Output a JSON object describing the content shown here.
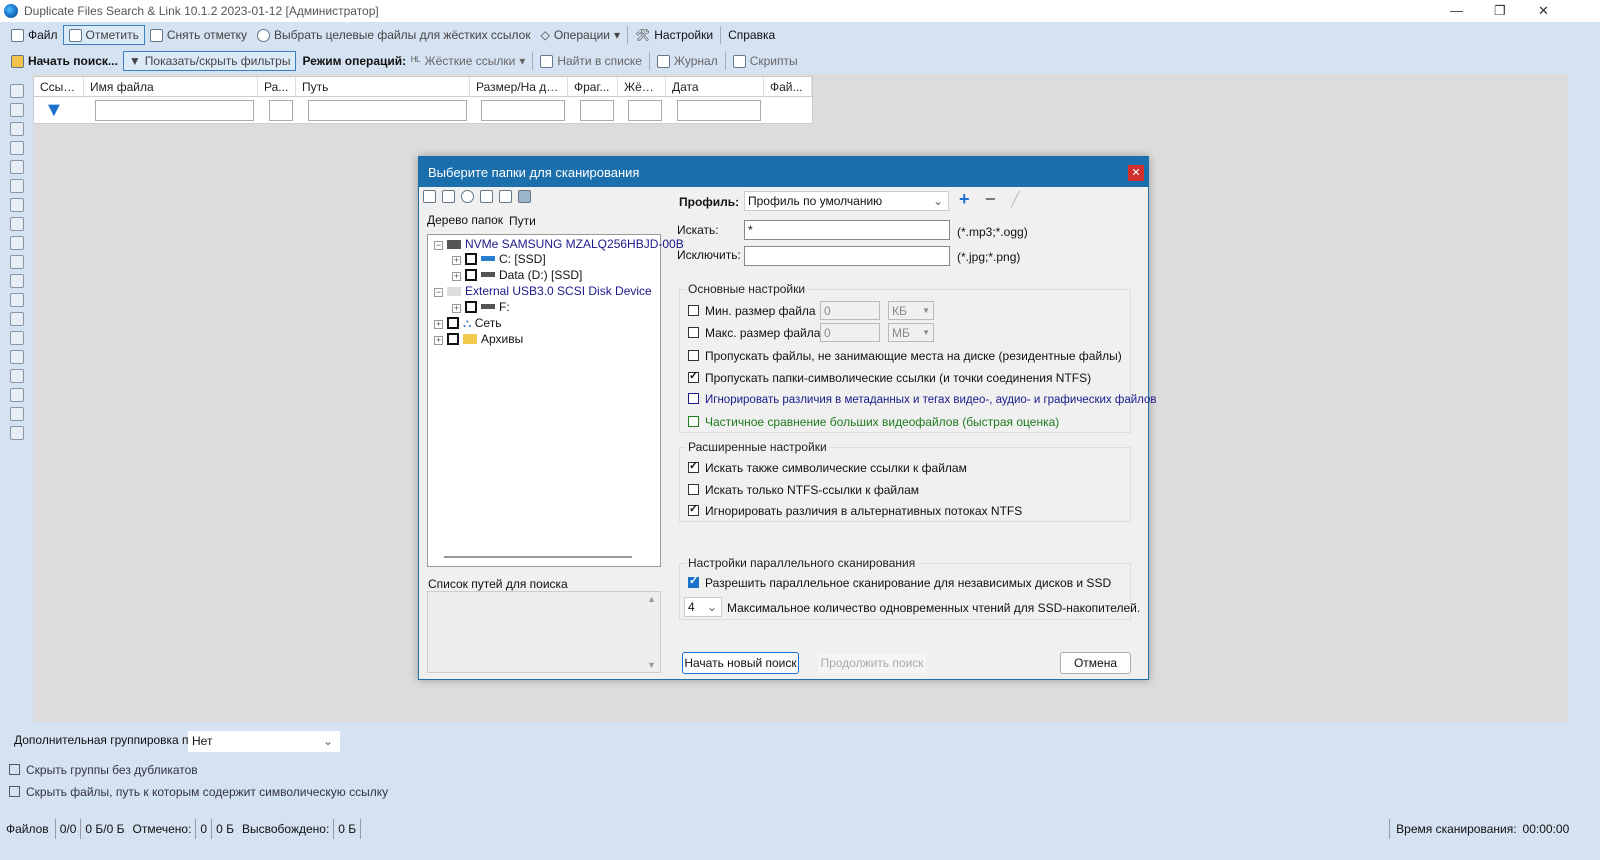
{
  "window": {
    "title": "Duplicate Files Search & Link 10.1.2 2023-01-12 [Администратор]"
  },
  "menu": [
    "Файл",
    "Отметить",
    "Снять отметку",
    "Выбрать целевые файлы для жёстких ссылок",
    "Операции",
    "Настройки",
    "Справка"
  ],
  "toolbar": {
    "start": "Начать поиск...",
    "filters": "Показать/скрыть фильтры",
    "mode_label": "Режим операций:",
    "mode": "Жёсткие ссылки",
    "find": "Найти в списке",
    "log": "Журнал",
    "scripts": "Скрипты"
  },
  "columns": [
    "Ссыл...",
    "Имя файла",
    "Ра...",
    "Путь",
    "Размер/На ди...",
    "Фраг...",
    "Жёст...",
    "Дата",
    "Фай..."
  ],
  "dialog": {
    "title": "Выберите папки для сканирования",
    "tabs": [
      "Дерево папок",
      "Пути"
    ],
    "tree": [
      {
        "label": "NVMe SAMSUNG MZALQ256HBJD-00B",
        "level": 0,
        "type": "device"
      },
      {
        "label": "C: [SSD]",
        "level": 1,
        "type": "drive"
      },
      {
        "label": "Data (D:) [SSD]",
        "level": 1,
        "type": "drive"
      },
      {
        "label": "External USB3.0 SCSI Disk Device",
        "level": 0,
        "type": "device"
      },
      {
        "label": "F:",
        "level": 1,
        "type": "drive"
      },
      {
        "label": "Сеть",
        "level": 0,
        "type": "network"
      },
      {
        "label": "Архивы",
        "level": 0,
        "type": "folder"
      }
    ],
    "paths_label": "Список путей для поиска",
    "profile_label": "Профиль:",
    "profile": "Профиль по умолчанию",
    "search_label": "Искать:",
    "search_value": "*",
    "search_hint": "(*.mp3;*.ogg)",
    "exclude_label": "Исключить:",
    "exclude_value": "",
    "exclude_hint": "(*.jpg;*.png)",
    "basic": {
      "title": "Основные настройки",
      "min_label": "Мин. размер файла",
      "min_value": "0",
      "min_unit": "КБ",
      "max_label": "Макс. размер файла",
      "max_value": "0",
      "max_unit": "МБ",
      "opts": [
        {
          "label": "Пропускать файлы, не занимающие места на диске (резидентные файлы)",
          "checked": false,
          "color": "#111111"
        },
        {
          "label": "Пропускать папки-символические ссылки (и точки соединения NTFS)",
          "checked": true,
          "color": "#111111"
        },
        {
          "label": "Игнорировать различия в метаданных и тегах видео-, аудио- и графических файлов",
          "checked": false,
          "color": "#1a1a8c"
        },
        {
          "label": "Частичное сравнение больших видеофайлов (быстрая оценка)",
          "checked": false,
          "color": "#1e7a1e"
        }
      ]
    },
    "advanced": {
      "title": "Расширенные настройки",
      "opts": [
        {
          "label": "Искать также символические ссылки к файлам",
          "checked": true
        },
        {
          "label": "Искать только NTFS-ссылки к файлам",
          "checked": false
        },
        {
          "label": "Игнорировать различия в альтернативных потоках NTFS",
          "checked": true
        }
      ]
    },
    "parallel": {
      "title": "Настройки параллельного сканирования",
      "allow": "Разрешить параллельное сканирование для независимых дисков и SSD",
      "allow_checked": true,
      "threads": "4",
      "threads_label": "Максимальное количество одновременных чтений для SSD-накопителей."
    },
    "buttons": {
      "start": "Начать новый поиск",
      "continue": "Продолжить поиск",
      "cancel": "Отмена"
    }
  },
  "bottom": {
    "group_label": "Дополнительная группировка по",
    "group_value": "Нет",
    "hide_groups": "Скрыть группы без дубликатов",
    "hide_symlinks": "Скрыть файлы, путь к которым содержит символическую ссылку"
  },
  "status": {
    "files_label": "Файлов",
    "files": "0/0",
    "size": "0 Б/0 Б",
    "marked_label": "Отмечено:",
    "marked": "0",
    "marked_size": "0 Б",
    "freed_label": "Высвобождено:",
    "freed": "0 Б",
    "time_label": "Время сканирования:",
    "time": "00:00:00"
  }
}
